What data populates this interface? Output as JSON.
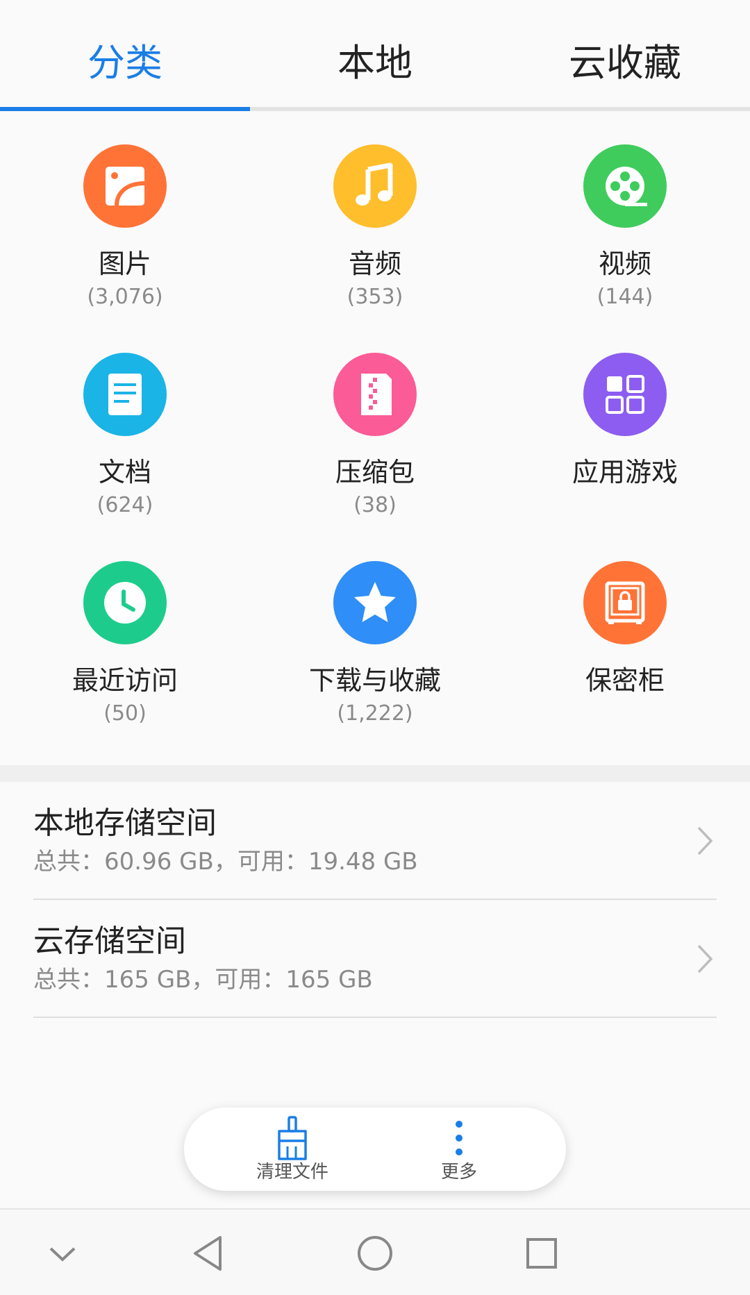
{
  "tabs": [
    {
      "label": "分类",
      "active": true
    },
    {
      "label": "本地",
      "active": false
    },
    {
      "label": "云收藏",
      "active": false
    }
  ],
  "categories": [
    {
      "label": "图片",
      "count": "(3,076)",
      "icon": "image-icon",
      "color": "#ff7337"
    },
    {
      "label": "音频",
      "count": "(353)",
      "icon": "music-icon",
      "color": "#ffbe2c"
    },
    {
      "label": "视频",
      "count": "(144)",
      "icon": "video-reel-icon",
      "color": "#3fcc5c"
    },
    {
      "label": "文档",
      "count": "(624)",
      "icon": "document-icon",
      "color": "#1bb4e6"
    },
    {
      "label": "压缩包",
      "count": "(38)",
      "icon": "zip-icon",
      "color": "#fb5b97"
    },
    {
      "label": "应用游戏",
      "count": "",
      "icon": "apps-grid-icon",
      "color": "#8c5df0"
    },
    {
      "label": "最近访问",
      "count": "(50)",
      "icon": "clock-icon",
      "color": "#1dcc8c"
    },
    {
      "label": "下载与收藏",
      "count": "(1,222)",
      "icon": "star-icon",
      "color": "#2f8ef7"
    },
    {
      "label": "保密柜",
      "count": "",
      "icon": "safe-lock-icon",
      "color": "#ff7337"
    }
  ],
  "storage": [
    {
      "title": "本地存储空间",
      "detail": "总共：60.96 GB，可用：19.48 GB"
    },
    {
      "title": "云存储空间",
      "detail": "总共：165 GB，可用：165 GB"
    }
  ],
  "actions": [
    {
      "label": "清理文件",
      "icon": "broom-icon"
    },
    {
      "label": "更多",
      "icon": "more-vertical-icon"
    }
  ],
  "colors": {
    "accent": "#1a7ee6"
  }
}
